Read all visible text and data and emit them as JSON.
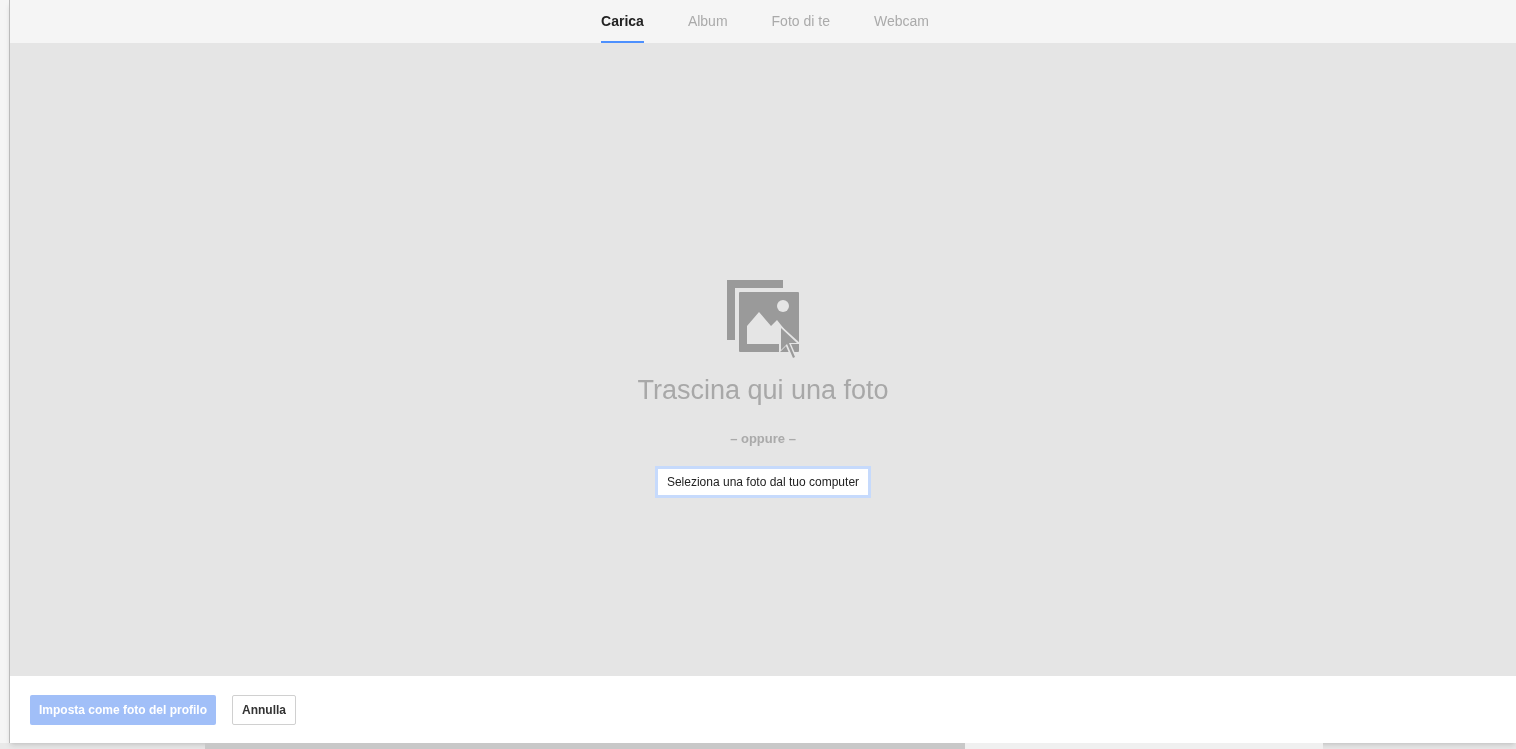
{
  "tabs": [
    {
      "label": "Carica",
      "selected": true
    },
    {
      "label": "Album",
      "selected": false
    },
    {
      "label": "Foto di te",
      "selected": false
    },
    {
      "label": "Webcam",
      "selected": false
    }
  ],
  "dropzone": {
    "title": "Trascina qui una foto",
    "separator": "– oppure –",
    "select_button": "Seleziona una foto dal tuo computer"
  },
  "footer": {
    "buttons": [
      {
        "label": "Imposta come foto del profilo",
        "kind": "primary",
        "disabled": true
      },
      {
        "label": "Annulla",
        "kind": "secondary",
        "disabled": false
      }
    ]
  }
}
